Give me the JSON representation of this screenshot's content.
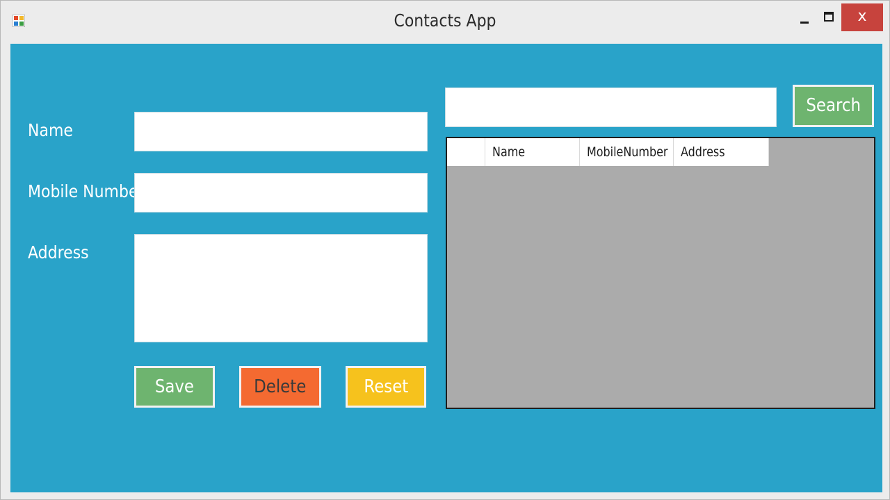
{
  "window": {
    "title": "Contacts App",
    "close_glyph": "x"
  },
  "form": {
    "name_label": "Name",
    "name_value": "",
    "mobile_label": "Mobile Number",
    "mobile_value": "",
    "address_label": "Address",
    "address_value": ""
  },
  "buttons": {
    "save": "Save",
    "delete": "Delete",
    "reset": "Reset",
    "search": "Search"
  },
  "search": {
    "value": ""
  },
  "grid": {
    "columns": [
      "Name",
      "MobileNumber",
      "Address"
    ],
    "rows": []
  },
  "colors": {
    "client_background": "#29a3c9",
    "save_button": "#6eb46f",
    "delete_button": "#f46a31",
    "reset_button": "#f6c21d",
    "search_button": "#6eb46f",
    "grid_background": "#ababab",
    "close_button": "#c7433d"
  },
  "icons": {
    "app": "app-icon",
    "minimize": "minimize-icon",
    "maximize": "maximize-icon",
    "close": "close-icon"
  }
}
